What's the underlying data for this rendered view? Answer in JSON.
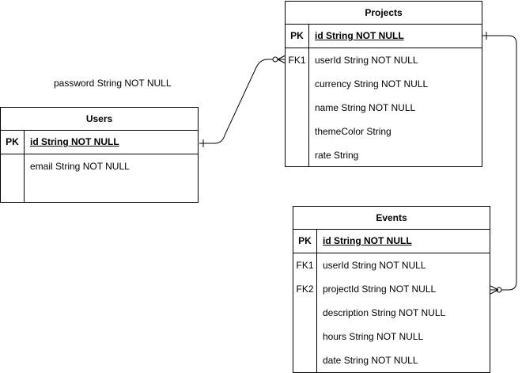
{
  "floating_label": "password String NOT NULL",
  "entities": {
    "projects": {
      "title": "Projects",
      "pk_key": "PK",
      "pk_field": "id String NOT NULL",
      "rows": [
        {
          "key": "FK1",
          "field": "userId String NOT NULL"
        },
        {
          "key": "",
          "field": "currency String NOT NULL"
        },
        {
          "key": "",
          "field": "name String NOT NULL"
        },
        {
          "key": "",
          "field": "themeColor String"
        },
        {
          "key": "",
          "field": "rate String"
        }
      ]
    },
    "users": {
      "title": "Users",
      "pk_key": "PK",
      "pk_field": "id String NOT NULL",
      "rows": [
        {
          "key": "",
          "field": "email String NOT NULL"
        },
        {
          "key": "",
          "field": ""
        }
      ]
    },
    "events": {
      "title": "Events",
      "pk_key": "PK",
      "pk_field": "id String NOT NULL",
      "rows": [
        {
          "key": "FK1",
          "field": "userId String NOT NULL"
        },
        {
          "key": "FK2",
          "field": "projectId String NOT NULL"
        },
        {
          "key": "",
          "field": "description String NOT NULL"
        },
        {
          "key": "",
          "field": "hours String NOT NULL"
        },
        {
          "key": "",
          "field": "date String NOT NULL"
        }
      ]
    }
  },
  "relationships": [
    {
      "from": "Users",
      "to": "Projects",
      "from_end": "one",
      "to_end": "zero-or-many"
    },
    {
      "from": "Projects",
      "to": "Events",
      "from_end": "one",
      "to_end": "zero-or-many"
    }
  ]
}
